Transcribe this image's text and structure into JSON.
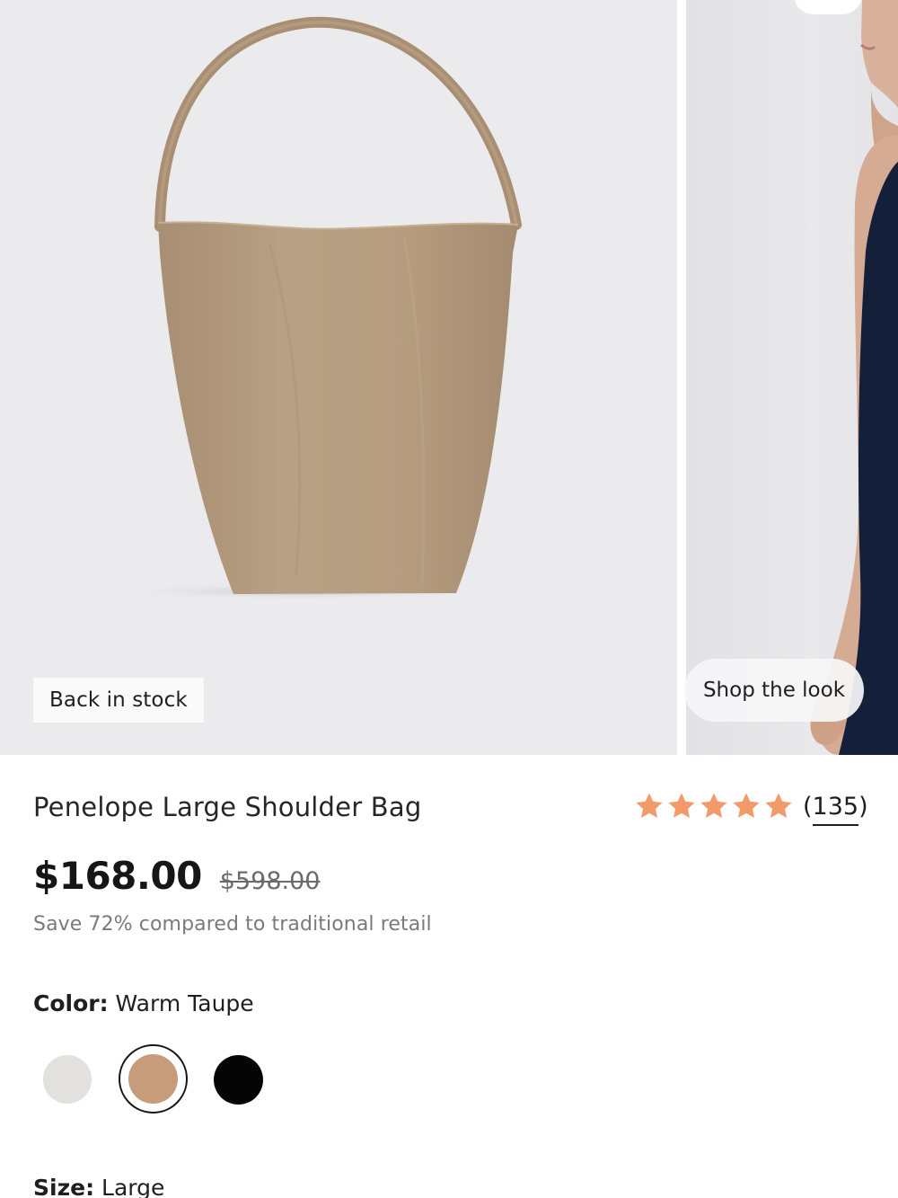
{
  "gallery": {
    "badge": "Back in stock",
    "shop_look": "Shop the look"
  },
  "product": {
    "name": "Penelope Large Shoulder Bag",
    "rating": 5,
    "review_count": "(135)",
    "price": "$168.00",
    "original_price": "$598.00",
    "savings_text": "Save 72% compared to traditional retail",
    "color_label": "Color:",
    "color_value": "Warm Taupe",
    "size_label": "Size:",
    "size_value": "Large"
  },
  "colors": {
    "accent_star": "#f29a6a",
    "bag": "#b39a7e",
    "swatches": [
      "#e3e1de",
      "#c79c7a",
      "#050505"
    ],
    "selected_swatch": 1
  }
}
